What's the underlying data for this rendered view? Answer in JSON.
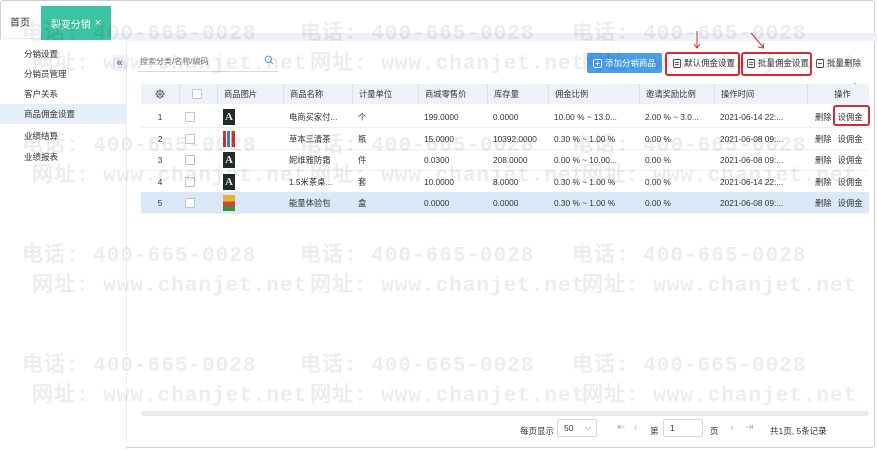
{
  "nav": {
    "home": "首页",
    "active_tab": "裂变分销",
    "close_symbol": "×"
  },
  "sidebar": {
    "collapse_symbol": "«",
    "items": [
      {
        "label": "分销设置"
      },
      {
        "label": "分销员管理"
      },
      {
        "label": "客户关系"
      },
      {
        "label": "商品佣金设置"
      },
      {
        "label": "业绩结算"
      },
      {
        "label": "业绩报表"
      }
    ]
  },
  "toolbar": {
    "search_placeholder": "搜索分类/名称/编码",
    "add_label": "添加分销商品",
    "default_commission_label": "默认佣金设置",
    "batch_commission_label": "批量佣金设置",
    "batch_delete_label": "批量删除"
  },
  "table": {
    "headers": [
      "",
      "",
      "商品图片",
      "商品名称",
      "计量单位",
      "商城零售价",
      "库存量",
      "佣金比例",
      "邀请奖励比例",
      "操作时间",
      "操作"
    ],
    "delete_label": "删除",
    "set_commission_label": "设佣金",
    "rows": [
      {
        "index": "1",
        "thumb": "A",
        "name": "电商买家付...",
        "unit": "个",
        "price": "199.0000",
        "stock": "0.0000",
        "commission": "10.00 % ~ 13.0...",
        "invite": "2.00 % ~ 3.0...",
        "time": "2021-06-14 22:..."
      },
      {
        "index": "2",
        "thumb": "",
        "name": "草本三清茶",
        "unit": "瓶",
        "price": "15.0000",
        "stock": "10392.0000",
        "commission": "0.30 % ~ 1.00 %",
        "invite": "0.00 %",
        "time": "2021-06-08 09:..."
      },
      {
        "index": "3",
        "thumb": "A",
        "name": "妮维雅防霜",
        "unit": "件",
        "price": "0.0300",
        "stock": "208.0000",
        "commission": "0.00 % ~ 10.00...",
        "invite": "0.00 %",
        "time": "2021-06-08 09:..."
      },
      {
        "index": "4",
        "thumb": "A",
        "name": "1.5米茶桌...",
        "unit": "套",
        "price": "10.0000",
        "stock": "8.0000",
        "commission": "0.30 % ~ 1.00 %",
        "invite": "0.00 %",
        "time": "2021-06-14 22:..."
      },
      {
        "index": "5",
        "thumb": "",
        "name": "能量体验包",
        "unit": "盒",
        "price": "0.0000",
        "stock": "0.0000",
        "commission": "0.30 % ~ 1.00 %",
        "invite": "0.00 %",
        "time": "2021-06-08 09:..."
      }
    ]
  },
  "footer": {
    "per_page_label": "每页显示",
    "per_page_value": "50",
    "page_prefix": "第",
    "page_value": "1",
    "page_suffix": "页",
    "summary": "共1页, 5条记录"
  },
  "watermark": {
    "phone": "电话: 400-665-0028",
    "site": "网址: www.chanjet.net"
  },
  "colors": {
    "accent_tab": "#3cc3a3",
    "primary_button": "#4a9eeb",
    "highlight": "#d9282f",
    "selected_row": "#dbe8f7",
    "header_bg": "#eef2f8"
  },
  "icons": [
    "collapse-left-icon",
    "search-icon",
    "add-icon",
    "document-icon",
    "delete-icon",
    "settings-gear-icon",
    "first-page-icon",
    "prev-page-icon",
    "next-page-icon",
    "last-page-icon",
    "chevron-down-icon",
    "red-arrow-down-icon"
  ]
}
